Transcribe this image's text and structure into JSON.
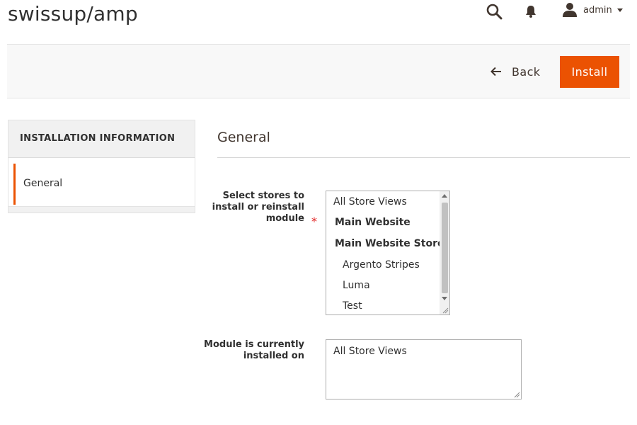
{
  "page": {
    "title": "swissup/amp"
  },
  "header": {
    "icons": [
      "search-icon",
      "bell-icon",
      "user-icon",
      "caret-down-icon"
    ],
    "user_name": "admin"
  },
  "toolbar": {
    "back_label": "Back",
    "install_label": "Install",
    "colors": {
      "accent": "#eb5202",
      "bar_bg": "#f8f8f8"
    }
  },
  "sidebar": {
    "heading": "INSTALLATION INFORMATION",
    "items": [
      {
        "label": "General",
        "active": true
      }
    ]
  },
  "form": {
    "section_title": "General",
    "stores_field": {
      "label": "Select stores to install or reinstall module",
      "required_mark": "*",
      "options": [
        {
          "label": "All Store Views",
          "style": "normal"
        },
        {
          "label": "Main Website",
          "style": "bold"
        },
        {
          "label": "Main Website Store",
          "style": "bold"
        },
        {
          "label": "Argento Stripes",
          "style": "indent"
        },
        {
          "label": "Luma",
          "style": "indent"
        },
        {
          "label": "Test",
          "style": "indent"
        }
      ]
    },
    "installed_field": {
      "label": "Module is currently installed on",
      "value": "All Store Views"
    }
  }
}
